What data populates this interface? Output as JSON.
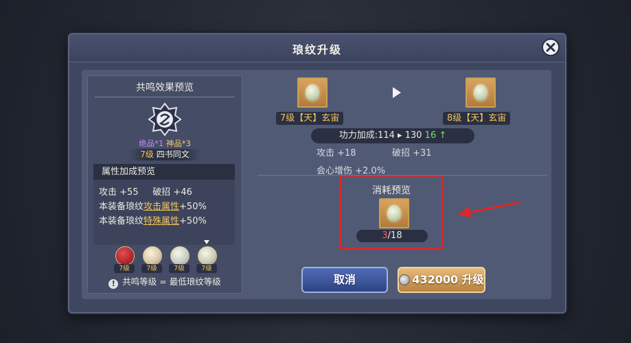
{
  "dialog": {
    "title": "琅纹升级"
  },
  "resonance": {
    "title": "共鸣效果预览",
    "quality_a": "绝品*1",
    "quality_b": "神品*3",
    "level": "7级",
    "level_suffix": " 四书同文",
    "attr_header": "属性加成预览",
    "attack_label": "攻击",
    "attack_value": "+55",
    "break_label": "破招",
    "break_value": "+46",
    "row2_prefix": "本装备琅纹",
    "row2_highlight": "攻击属性",
    "row2_value": "+50%",
    "row3_prefix": "本装备琅纹",
    "row3_highlight": "特殊属性",
    "row3_value": "+50%",
    "gems": [
      {
        "level": "7级",
        "color": "#b3252b",
        "icon": "red-gem-icon"
      },
      {
        "level": "7级",
        "color": "#d9c7a6",
        "icon": "pendant-gem-icon"
      },
      {
        "level": "7级",
        "color": "#c6ccc2",
        "icon": "pendant-gem-icon"
      },
      {
        "level": "7级",
        "color": "#c9c9b5",
        "icon": "pendant-gem-icon",
        "selected": true
      }
    ],
    "note": "共鸣等级 = 最低琅纹等级"
  },
  "upgrade": {
    "from_label": "7级【天】玄宙",
    "to_label": "8级【天】玄宙",
    "power_text": "功力加成:114 ▸ 130 ",
    "power_gain": "16 ↑",
    "stat_attack": "攻击 +18",
    "stat_break": "破招 +31",
    "stat_crit": "会心增伤 +2.0%"
  },
  "consume": {
    "title": "消耗预览",
    "have": "3",
    "need": "/18"
  },
  "buttons": {
    "cancel": "取消",
    "upgrade_cost": "432000",
    "upgrade_label": " 升级"
  },
  "colors": {
    "accent_gold": "#f4c45b",
    "highlight_red": "#e02626",
    "gain_green": "#7be36b"
  }
}
